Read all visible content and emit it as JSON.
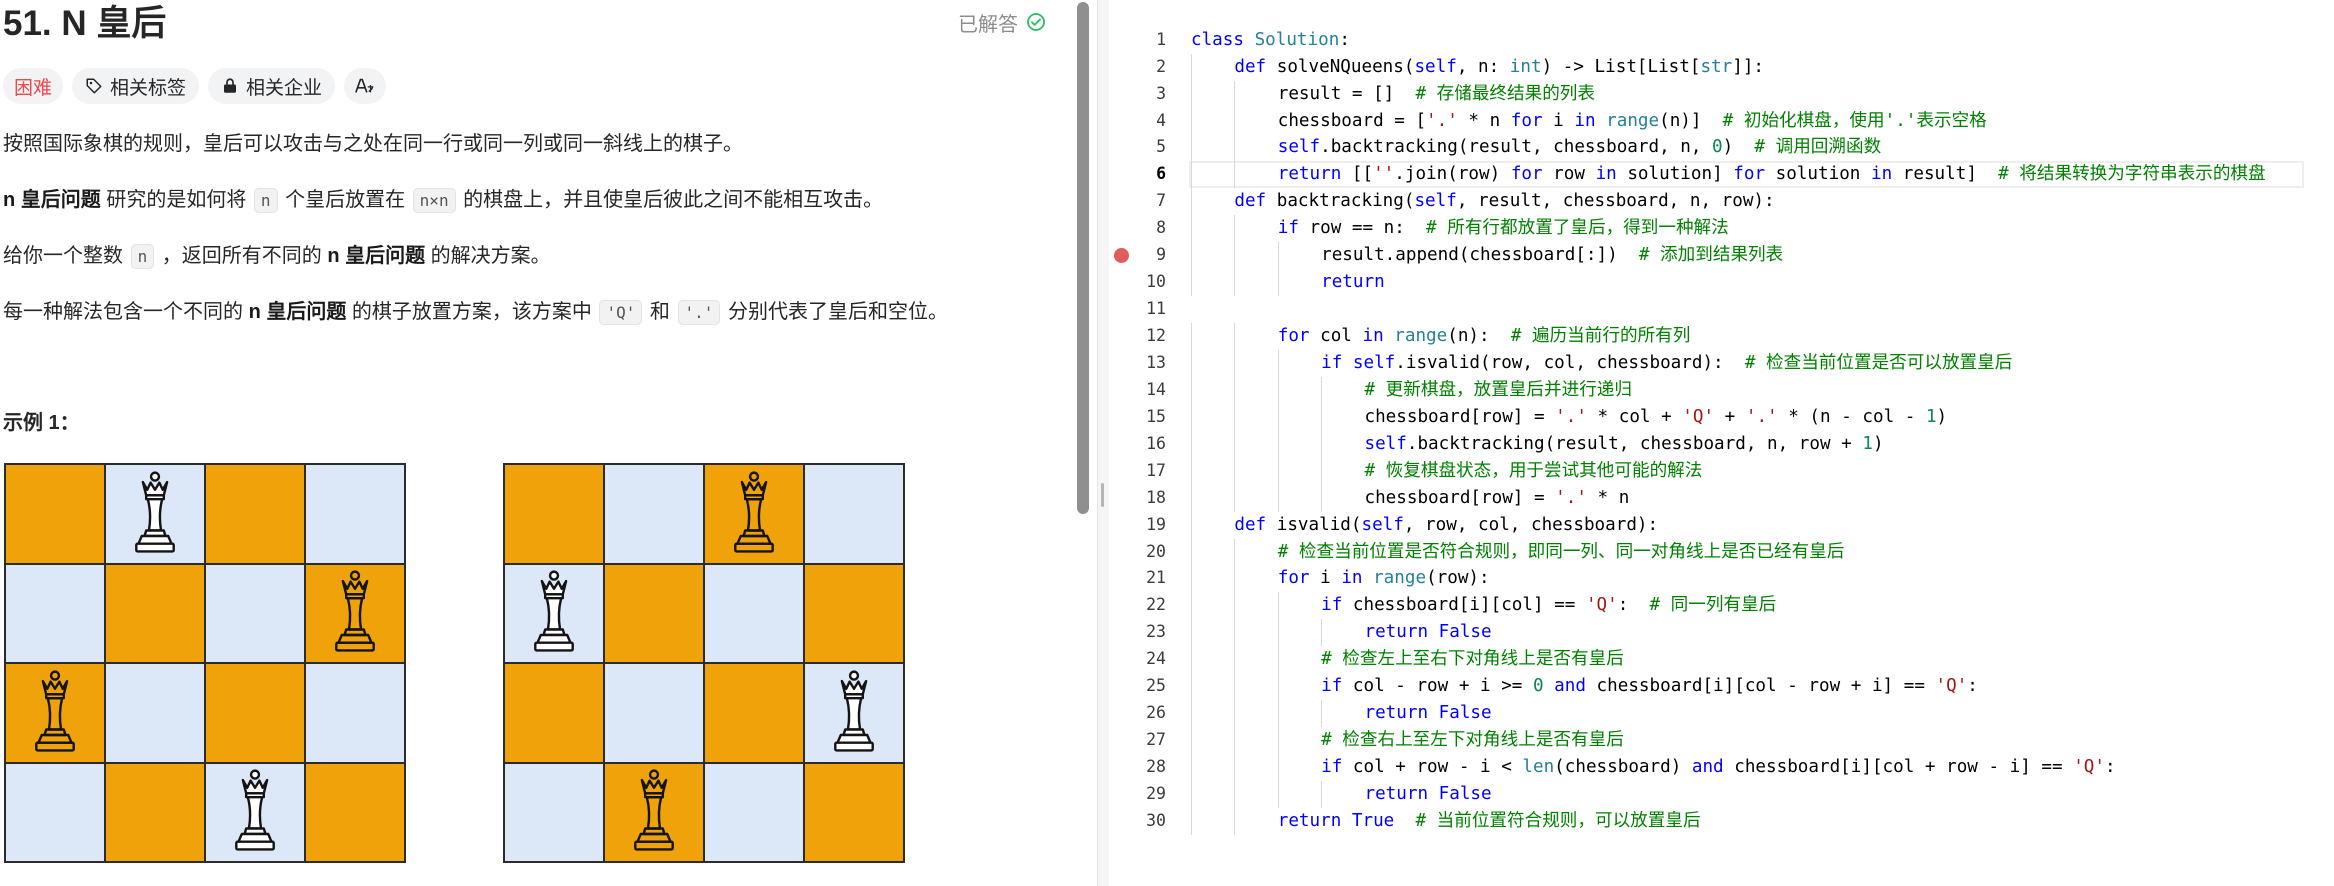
{
  "colors": {
    "board_dark": "#f0a20b",
    "board_light": "#dce8f8",
    "board_grid": "#2b2b2b",
    "difficulty": "#f0474a",
    "solved": "#2cbc63",
    "keyword": "#0000ff",
    "type": "#267f99",
    "string": "#a31515",
    "number": "#098658",
    "comment": "#008000",
    "breakpoint": "#e25c5c"
  },
  "icons": {
    "status": "check-circle-icon",
    "topics": "tag-icon",
    "companies": "lock-icon",
    "language": "translate-icon",
    "queen": "queen-icon"
  },
  "header": {
    "title": "51. N 皇后",
    "status": "已解答"
  },
  "tags": {
    "difficulty": "困难",
    "topics": "相关标签",
    "companies": "相关企业"
  },
  "description": {
    "paragraphs": [
      [
        {
          "text": "按照国际象棋的规则，皇后可以攻击与之处在同一行或同一列或同一斜线上的棋子。"
        }
      ],
      [
        {
          "text": "n 皇后问题",
          "bold": true
        },
        {
          "text": " 研究的是如何将 "
        },
        {
          "text": "n",
          "code": true
        },
        {
          "text": " 个皇后放置在 "
        },
        {
          "text": "n×n",
          "code": true
        },
        {
          "text": " 的棋盘上，并且使皇后彼此之间不能相互攻击。"
        }
      ],
      [
        {
          "text": "给你一个整数 "
        },
        {
          "text": "n",
          "code": true
        },
        {
          "text": " ，返回所有不同的 "
        },
        {
          "text": "n 皇后问题",
          "bold": true
        },
        {
          "text": " 的解决方案。"
        }
      ],
      [
        {
          "text": "每一种解法包含一个不同的 "
        },
        {
          "text": "n 皇后问题",
          "bold": true
        },
        {
          "text": " 的棋子放置方案，该方案中 "
        },
        {
          "text": "'Q'",
          "code": true
        },
        {
          "text": " 和 "
        },
        {
          "text": "'.'",
          "code": true
        },
        {
          "text": " 分别代表了皇后和空位。"
        }
      ]
    ]
  },
  "example": {
    "heading": "示例 1：",
    "boards": [
      {
        "queen_columns": [
          1,
          3,
          0,
          2
        ]
      },
      {
        "queen_columns": [
          2,
          0,
          3,
          1
        ]
      }
    ]
  },
  "editor": {
    "active_line": 6,
    "breakpoint_line": 9,
    "lines": [
      {
        "n": 1,
        "code": "class Solution:"
      },
      {
        "n": 2,
        "code": "    def solveNQueens(self, n: int) -> List[List[str]]:"
      },
      {
        "n": 3,
        "code": "        result = []  # 存储最终结果的列表"
      },
      {
        "n": 4,
        "code": "        chessboard = ['.' * n for i in range(n)]  # 初始化棋盘，使用'.'表示空格"
      },
      {
        "n": 5,
        "code": "        self.backtracking(result, chessboard, n, 0)  # 调用回溯函数"
      },
      {
        "n": 6,
        "code": "        return [[''.join(row) for row in solution] for solution in result]  # 将结果转换为字符串表示的棋盘"
      },
      {
        "n": 7,
        "code": "    def backtracking(self, result, chessboard, n, row):"
      },
      {
        "n": 8,
        "code": "        if row == n:  # 所有行都放置了皇后，得到一种解法"
      },
      {
        "n": 9,
        "code": "            result.append(chessboard[:])  # 添加到结果列表"
      },
      {
        "n": 10,
        "code": "            return"
      },
      {
        "n": 11,
        "code": ""
      },
      {
        "n": 12,
        "code": "        for col in range(n):  # 遍历当前行的所有列"
      },
      {
        "n": 13,
        "code": "            if self.isvalid(row, col, chessboard):  # 检查当前位置是否可以放置皇后"
      },
      {
        "n": 14,
        "code": "                # 更新棋盘，放置皇后并进行递归"
      },
      {
        "n": 15,
        "code": "                chessboard[row] = '.' * col + 'Q' + '.' * (n - col - 1)"
      },
      {
        "n": 16,
        "code": "                self.backtracking(result, chessboard, n, row + 1)"
      },
      {
        "n": 17,
        "code": "                # 恢复棋盘状态，用于尝试其他可能的解法"
      },
      {
        "n": 18,
        "code": "                chessboard[row] = '.' * n"
      },
      {
        "n": 19,
        "code": "    def isvalid(self, row, col, chessboard):"
      },
      {
        "n": 20,
        "code": "        # 检查当前位置是否符合规则，即同一列、同一对角线上是否已经有皇后"
      },
      {
        "n": 21,
        "code": "        for i in range(row):"
      },
      {
        "n": 22,
        "code": "            if chessboard[i][col] == 'Q':  # 同一列有皇后"
      },
      {
        "n": 23,
        "code": "                return False"
      },
      {
        "n": 24,
        "code": "            # 检查左上至右下对角线上是否有皇后"
      },
      {
        "n": 25,
        "code": "            if col - row + i >= 0 and chessboard[i][col - row + i] == 'Q':"
      },
      {
        "n": 26,
        "code": "                return False"
      },
      {
        "n": 27,
        "code": "            # 检查右上至左下对角线上是否有皇后"
      },
      {
        "n": 28,
        "code": "            if col + row - i < len(chessboard) and chessboard[i][col + row - i] == 'Q':"
      },
      {
        "n": 29,
        "code": "                return False"
      },
      {
        "n": 30,
        "code": "        return True  # 当前位置符合规则，可以放置皇后"
      }
    ]
  }
}
